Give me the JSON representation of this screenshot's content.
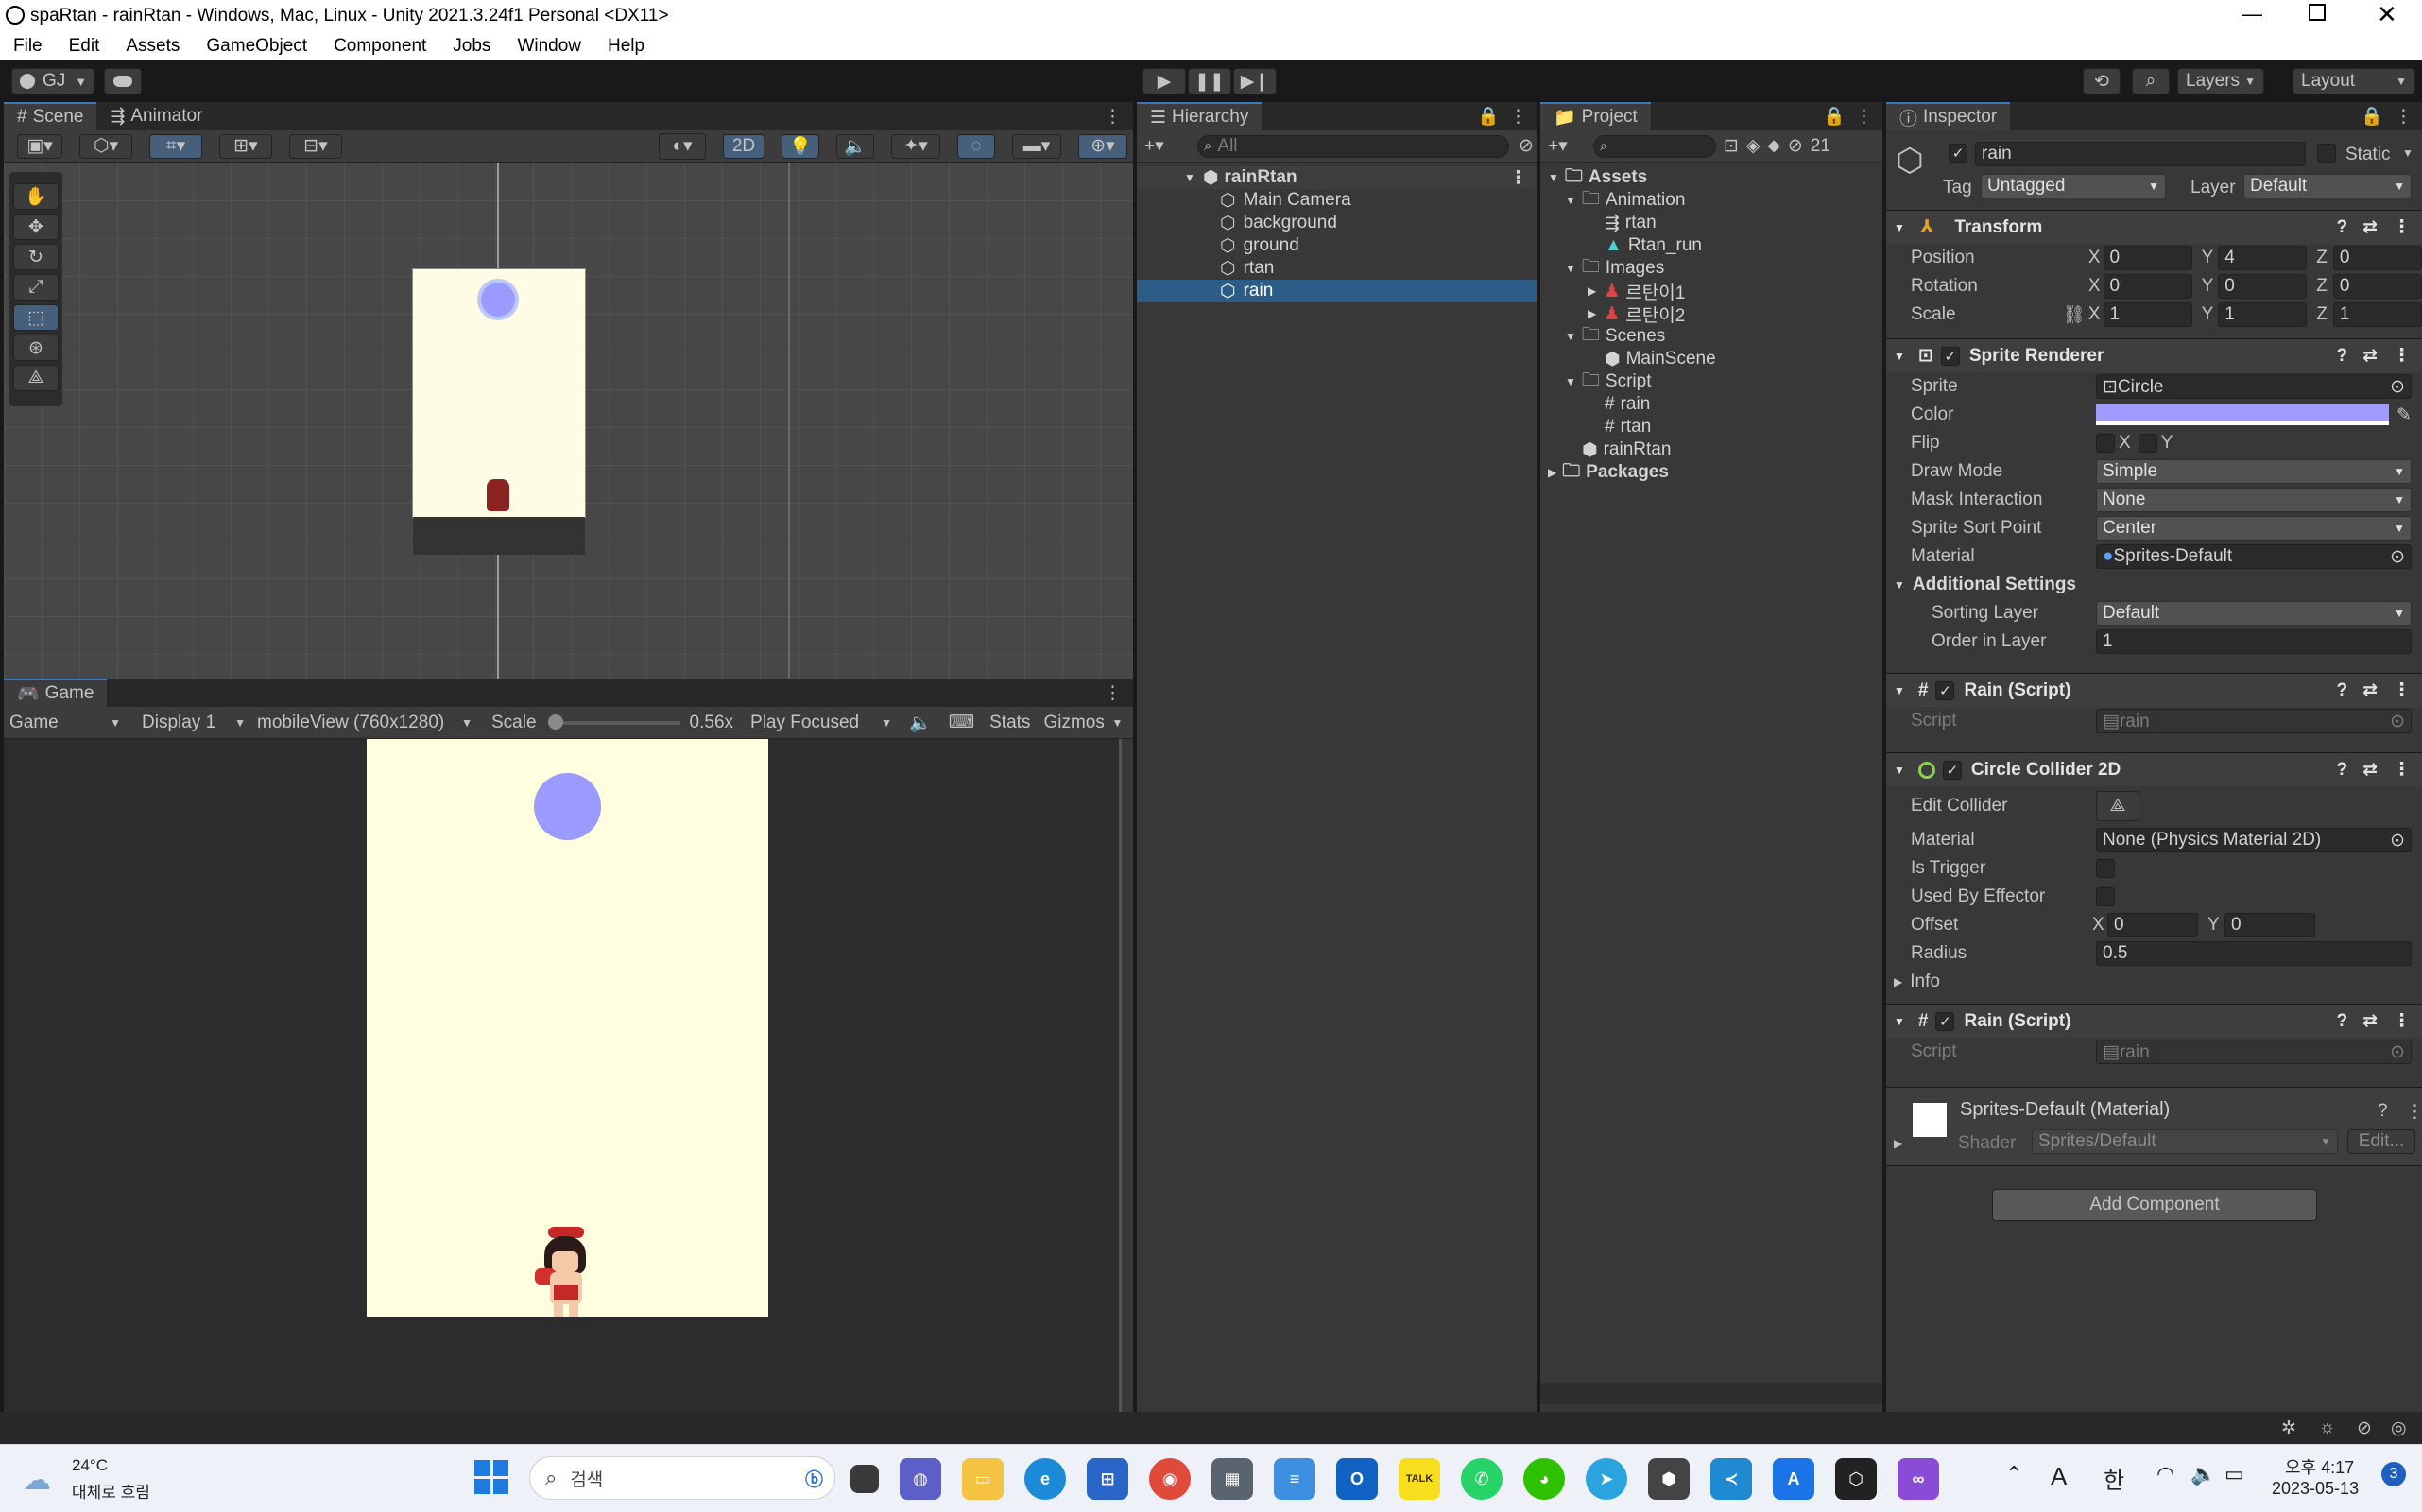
{
  "window": {
    "title": "spaRtan - rainRtan - Windows, Mac, Linux - Unity 2021.3.24f1 Personal <DX11>"
  },
  "menu": [
    "File",
    "Edit",
    "Assets",
    "GameObject",
    "Component",
    "Jobs",
    "Window",
    "Help"
  ],
  "toolbar": {
    "account": "GJ",
    "layers": "Layers",
    "layout": "Layout"
  },
  "scene": {
    "tab_scene": "Scene",
    "tab_animator": "Animator",
    "mode_2d": "2D"
  },
  "game": {
    "tab": "Game",
    "view": "Game",
    "display": "Display 1",
    "resolution": "mobileView (760x1280)",
    "scale_label": "Scale",
    "scale_value": "0.56x",
    "play_focused": "Play Focused",
    "stats": "Stats",
    "gizmos": "Gizmos"
  },
  "hierarchy": {
    "tab": "Hierarchy",
    "search_placeholder": "All",
    "root": "rainRtan",
    "items": [
      "Main Camera",
      "background",
      "ground",
      "rtan",
      "rain"
    ]
  },
  "project": {
    "tab": "Project",
    "hidden_count": "21",
    "tree": {
      "assets": "Assets",
      "animation": "Animation",
      "anim_rtan": "rtan",
      "anim_rtan_run": "Rtan_run",
      "images": "Images",
      "img1": "르탄이1",
      "img2": "르탄이2",
      "scenes": "Scenes",
      "main_scene": "MainScene",
      "script": "Script",
      "script_rain": "rain",
      "script_rtan": "rtan",
      "prefab": "rainRtan",
      "packages": "Packages"
    }
  },
  "inspector": {
    "tab": "Inspector",
    "name": "rain",
    "static_label": "Static",
    "tag_label": "Tag",
    "tag": "Untagged",
    "layer_label": "Layer",
    "layer": "Default",
    "transform": {
      "title": "Transform",
      "position_label": "Position",
      "rotation_label": "Rotation",
      "scale_label": "Scale",
      "x": "X",
      "y": "Y",
      "z": "Z",
      "position": [
        "0",
        "4",
        "0"
      ],
      "rotation": [
        "0",
        "0",
        "0"
      ],
      "scale": [
        "1",
        "1",
        "1"
      ]
    },
    "sprite_renderer": {
      "title": "Sprite Renderer",
      "sprite_label": "Sprite",
      "sprite": "Circle",
      "color_label": "Color",
      "color": "#a09cff",
      "flip_label": "Flip",
      "flip_x": "X",
      "flip_y": "Y",
      "draw_mode_label": "Draw Mode",
      "draw_mode": "Simple",
      "mask_label": "Mask Interaction",
      "mask": "None",
      "sort_point_label": "Sprite Sort Point",
      "sort_point": "Center",
      "material_label": "Material",
      "material": "Sprites-Default",
      "additional_label": "Additional Settings",
      "sorting_layer_label": "Sorting Layer",
      "sorting_layer": "Default",
      "order_label": "Order in Layer",
      "order": "1"
    },
    "rain_script_1": {
      "title": "Rain (Script)",
      "script_label": "Script",
      "script": "rain"
    },
    "circle_collider": {
      "title": "Circle Collider 2D",
      "edit_label": "Edit Collider",
      "material_label": "Material",
      "material": "None (Physics Material 2D)",
      "trigger_label": "Is Trigger",
      "effector_label": "Used By Effector",
      "offset_label": "Offset",
      "offset_x": "0",
      "offset_y": "0",
      "x": "X",
      "y": "Y",
      "radius_label": "Radius",
      "radius": "0.5",
      "info_label": "Info"
    },
    "rain_script_2": {
      "title": "Rain (Script)",
      "script_label": "Script",
      "script": "rain"
    },
    "material_block": {
      "title": "Sprites-Default (Material)",
      "shader_label": "Shader",
      "shader": "Sprites/Default",
      "edit": "Edit..."
    },
    "add_component": "Add Component"
  },
  "taskbar": {
    "temp": "24°C",
    "weather": "대체로 흐림",
    "search": "검색",
    "lang_a": "A",
    "lang_han": "한",
    "time": "오후 4:17",
    "date": "2023-05-13",
    "notif": "3",
    "kakao": "TALK"
  },
  "colors": {
    "accent": "#3a79bb",
    "rain_circle": "#9a9aff",
    "game_bg": "#ffffe0"
  }
}
